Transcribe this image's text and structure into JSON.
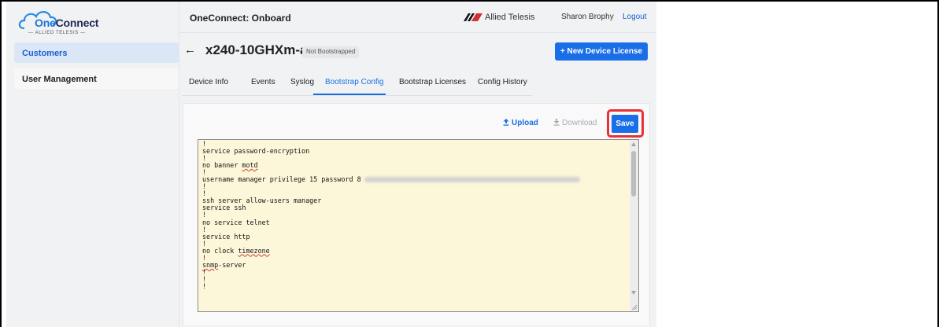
{
  "logo": {
    "prefix": "One",
    "suffix": "Connect",
    "tagline": "ALLIED TELESIS"
  },
  "sidebar": {
    "items": [
      {
        "label": "Customers",
        "active": true
      },
      {
        "label": "User Management",
        "active": false
      }
    ]
  },
  "header": {
    "title": "OneConnect: Onboard",
    "brand": "Allied Telesis",
    "user": "Sharon Brophy",
    "logout": "Logout"
  },
  "device": {
    "back": "←",
    "name": "x240-10GHXm-a",
    "status": "Not Bootstrapped",
    "new_license_label": "+ New Device License"
  },
  "tabs": [
    {
      "label": "Device Info",
      "active": false
    },
    {
      "label": "Events",
      "active": false
    },
    {
      "label": "Syslog",
      "active": false
    },
    {
      "label": "Bootstrap Config",
      "active": true
    },
    {
      "label": "Bootstrap Licenses",
      "active": false
    },
    {
      "label": "Config History",
      "active": false
    }
  ],
  "toolbar": {
    "upload": "Upload",
    "download": "Download",
    "save": "Save"
  },
  "editor": {
    "lines": [
      {
        "text": "!"
      },
      {
        "text": "service password-encryption"
      },
      {
        "text": "!"
      },
      {
        "pre": "no banner ",
        "sq": "motd"
      },
      {
        "text": "!"
      },
      {
        "text": "username manager privilege 15 password 8",
        "blurred": true
      },
      {
        "text": "!"
      },
      {
        "text": "!"
      },
      {
        "text": "ssh server allow-users manager"
      },
      {
        "text": "service ssh"
      },
      {
        "text": "!"
      },
      {
        "text": "no service telnet"
      },
      {
        "text": "!"
      },
      {
        "text": "service http"
      },
      {
        "text": "!"
      },
      {
        "pre": "no clock ",
        "sq": "timezone"
      },
      {
        "text": "!"
      },
      {
        "sq": "snmp",
        "post": "-server"
      },
      {
        "text": "!"
      },
      {
        "text": "!"
      },
      {
        "text": "!"
      }
    ]
  },
  "colors": {
    "accent": "#1a6ee8",
    "highlight": "#e53238",
    "editor_bg": "#fdf7d9"
  }
}
